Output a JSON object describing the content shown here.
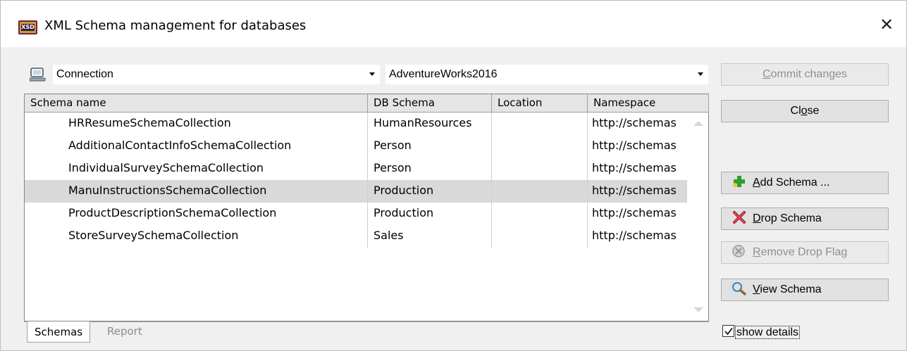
{
  "window": {
    "title": "XML Schema management for databases",
    "icon": "xsd-icon",
    "icon_text": "XSD",
    "close_glyph": "✕"
  },
  "connection": {
    "label": "Connection",
    "icon": "database-connection-icon",
    "database": "AdventureWorks2016"
  },
  "table": {
    "columns": [
      "Schema name",
      "DB Schema",
      "Location",
      "Namespace"
    ],
    "rows": [
      {
        "name": "HRResumeSchemaCollection",
        "db_schema": "HumanResources",
        "location": "",
        "namespace": "http://schemas",
        "selected": false
      },
      {
        "name": "AdditionalContactInfoSchemaCollection",
        "db_schema": "Person",
        "location": "",
        "namespace": "http://schemas",
        "selected": false
      },
      {
        "name": "IndividualSurveySchemaCollection",
        "db_schema": "Person",
        "location": "",
        "namespace": "http://schemas",
        "selected": false
      },
      {
        "name": "ManuInstructionsSchemaCollection",
        "db_schema": "Production",
        "location": "",
        "namespace": "http://schemas",
        "selected": true
      },
      {
        "name": "ProductDescriptionSchemaCollection",
        "db_schema": "Production",
        "location": "",
        "namespace": "http://schemas",
        "selected": false
      },
      {
        "name": "StoreSurveySchemaCollection",
        "db_schema": "Sales",
        "location": "",
        "namespace": "http://schemas",
        "selected": false
      }
    ]
  },
  "tabs": [
    {
      "label": "Schemas",
      "active": true
    },
    {
      "label": "Report",
      "active": false
    }
  ],
  "buttons": {
    "commit": {
      "mnemonic": "C",
      "rest": "ommit changes",
      "enabled": false
    },
    "close": {
      "pre": "Cl",
      "mnemonic": "o",
      "rest": "se",
      "enabled": true
    },
    "add_schema": {
      "mnemonic": "A",
      "rest": "dd Schema ...",
      "enabled": true,
      "icon": "plus-icon"
    },
    "drop_schema": {
      "mnemonic": "D",
      "rest": "rop Schema",
      "enabled": true,
      "icon": "drop-x-icon"
    },
    "remove_drop_flag": {
      "mnemonic": "R",
      "rest": "emove Drop Flag",
      "enabled": false,
      "icon": "remove-flag-icon"
    },
    "view_schema": {
      "mnemonic": "V",
      "rest": "iew Schema",
      "enabled": true,
      "icon": "magnifier-icon"
    }
  },
  "show_details": {
    "label": "show details",
    "checked": true
  },
  "colors": {
    "selected_row": "#d9d9d9",
    "add_icon_green": "#2e9e2e",
    "drop_icon_red": "#b0192a"
  }
}
